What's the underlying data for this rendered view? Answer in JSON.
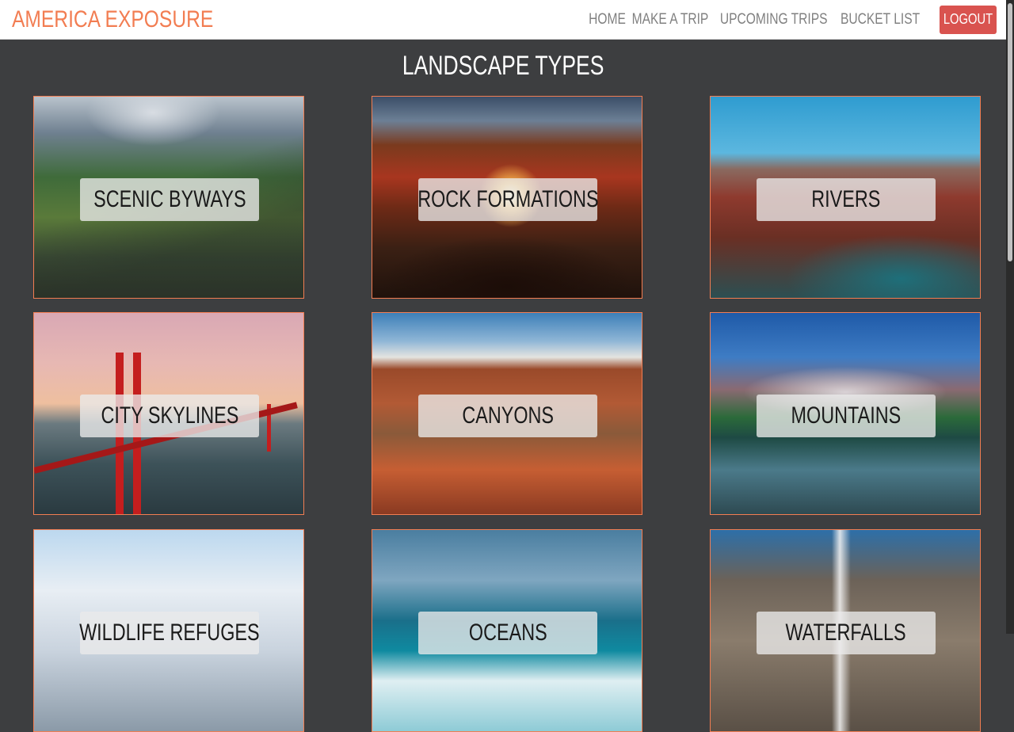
{
  "brand": "AMERICA EXPOSURE",
  "nav": {
    "home": "HOME",
    "make_trip": "MAKE A TRIP",
    "upcoming": "UPCOMING TRIPS",
    "bucket": "BUCKET LIST",
    "logout": "LOGOUT"
  },
  "page": {
    "title": "LANDSCAPE TYPES"
  },
  "cards": [
    {
      "label": "SCENIC BYWAYS"
    },
    {
      "label": "ROCK FORMATIONS"
    },
    {
      "label": "RIVERS"
    },
    {
      "label": "CITY SKYLINES"
    },
    {
      "label": "CANYONS"
    },
    {
      "label": "MOUNTAINS"
    },
    {
      "label": "WILDLIFE REFUGES"
    },
    {
      "label": "OCEANS"
    },
    {
      "label": "WATERFALLS"
    }
  ],
  "colors": {
    "brand": "#f27d52",
    "logout": "#d9534f",
    "background": "#3d3e40"
  }
}
